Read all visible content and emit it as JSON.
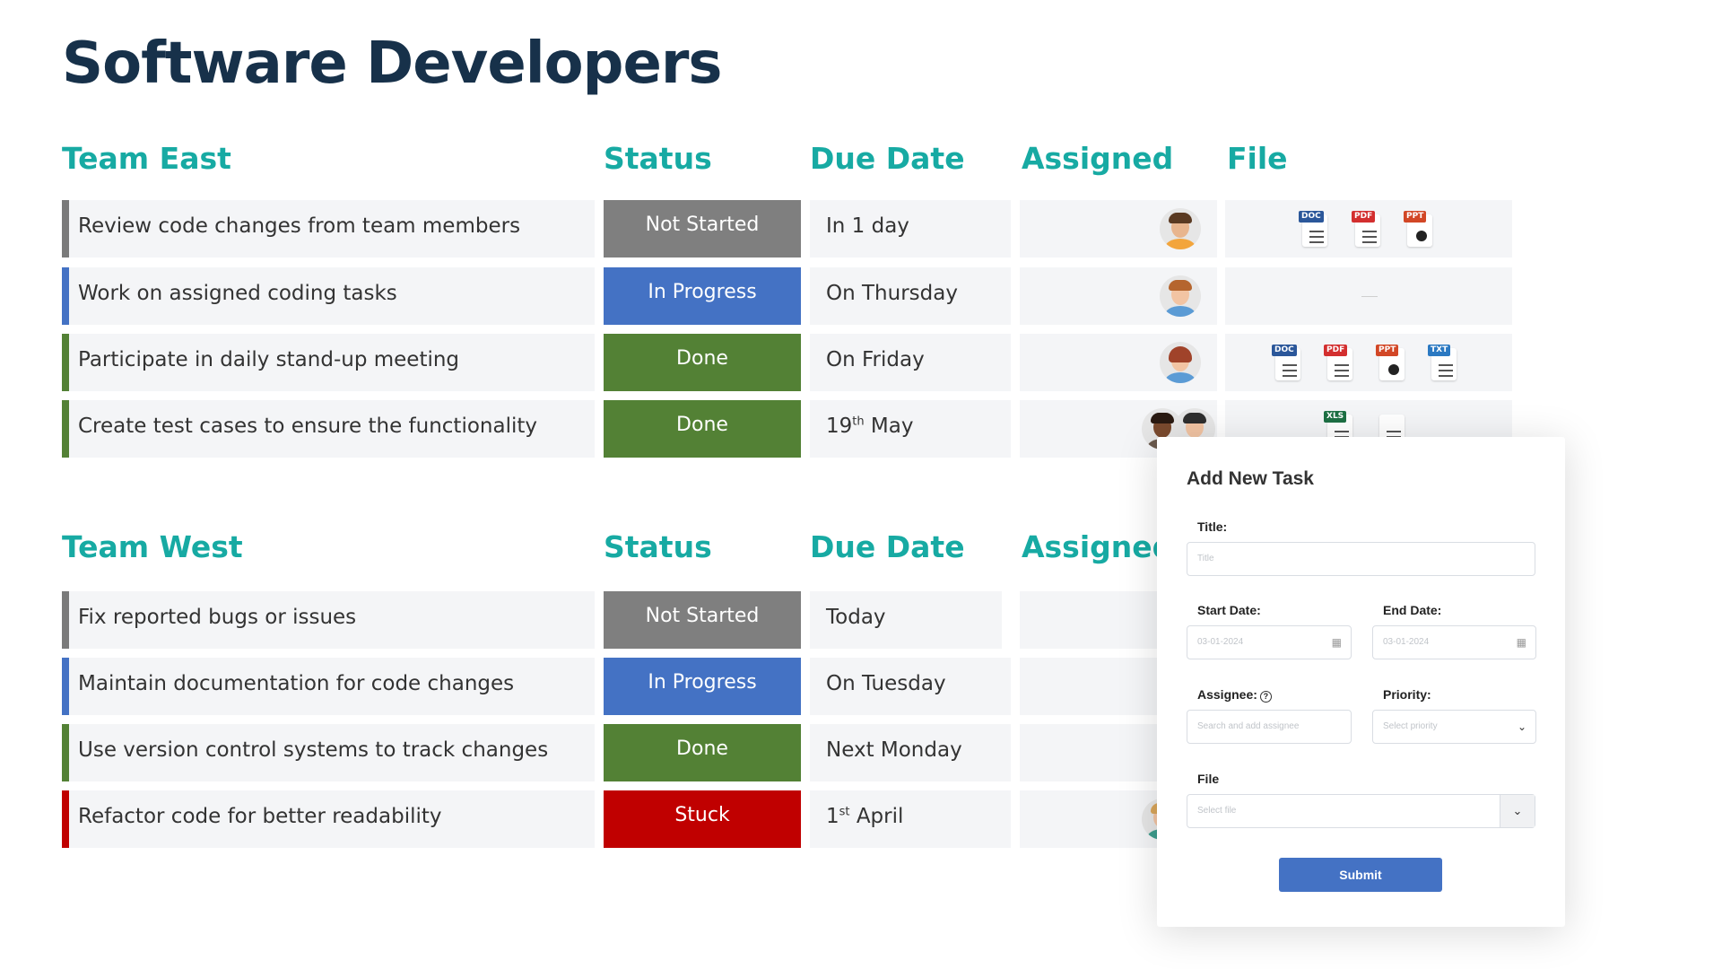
{
  "page_title": "Software Developers",
  "teams": [
    {
      "name": "Team East",
      "headers": {
        "status": "Status",
        "due": "Due Date",
        "assigned": "Assigned",
        "file": "File"
      },
      "tasks": [
        {
          "title": "Review code changes from team members",
          "status": "Not Started",
          "due": "In 1 day",
          "files": [
            "DOC",
            "PDF",
            "PPT"
          ]
        },
        {
          "title": "Work on assigned coding tasks",
          "status": "In Progress",
          "due": "On Thursday",
          "files": []
        },
        {
          "title": "Participate in daily stand-up meeting",
          "status": "Done",
          "due": "On Friday",
          "files": [
            "DOC",
            "PDF",
            "PPT",
            "TXT"
          ]
        },
        {
          "title": "Create test cases to ensure the functionality",
          "status": "Done",
          "due_main": "19",
          "due_sup": "th",
          "due_tail": " May",
          "files": [
            "XLS",
            ""
          ]
        }
      ]
    },
    {
      "name": "Team West",
      "headers": {
        "status": "Status",
        "due": "Due Date",
        "assigned": "Assigned"
      },
      "tasks": [
        {
          "title": "Fix reported bugs or issues",
          "status": "Not Started",
          "due": "Today"
        },
        {
          "title": "Maintain documentation for code changes",
          "status": "In Progress",
          "due": "On Tuesday"
        },
        {
          "title": "Use version control systems to track changes",
          "status": "Done",
          "due": "Next Monday"
        },
        {
          "title": "Refactor code for better readability",
          "status": "Stuck",
          "due_main": "1",
          "due_sup": "st",
          "due_tail": " April"
        }
      ]
    }
  ],
  "status_colors": {
    "Not Started": "#7f7f7f",
    "In Progress": "#4472c4",
    "Done": "#538135",
    "Stuck": "#c00000"
  },
  "file_tag_colors": {
    "DOC": "#2b579a",
    "PDF": "#d32f2f",
    "PPT": "#d24726",
    "TXT": "#2b79c2",
    "XLS": "#1d7044"
  },
  "modal": {
    "title": "Add New Task",
    "title_label": "Title:",
    "title_placeholder": "Title",
    "start_label": "Start Date:",
    "start_value": "03-01-2024",
    "end_label": "End Date:",
    "end_value": "03-01-2024",
    "assignee_label": "Assignee:",
    "assignee_placeholder": "Search and add assignee",
    "priority_label": "Priority:",
    "priority_placeholder": "Select priority",
    "file_label": "File",
    "file_placeholder": "Select file",
    "submit_label": "Submit"
  }
}
